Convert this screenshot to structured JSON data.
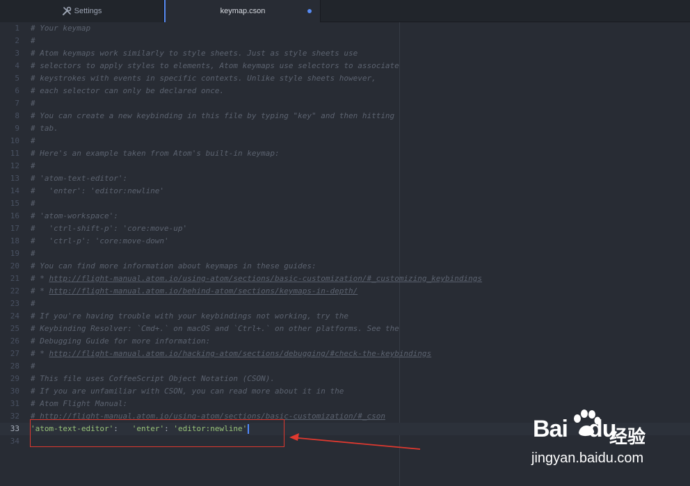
{
  "tabs": [
    {
      "label": "Settings",
      "icon": "tools-icon",
      "active": false
    },
    {
      "label": "keymap.cson",
      "active": true,
      "modified": true
    }
  ],
  "editor": {
    "active_line": 33,
    "lines": [
      {
        "n": "1",
        "segments": [
          {
            "t": "# Your keymap",
            "c": "comment"
          }
        ]
      },
      {
        "n": "2",
        "segments": [
          {
            "t": "#",
            "c": "comment"
          }
        ]
      },
      {
        "n": "3",
        "segments": [
          {
            "t": "# Atom keymaps work similarly to style sheets. Just as style sheets use",
            "c": "comment"
          }
        ]
      },
      {
        "n": "4",
        "segments": [
          {
            "t": "# selectors to apply styles to elements, Atom keymaps use selectors to associate",
            "c": "comment"
          }
        ]
      },
      {
        "n": "5",
        "segments": [
          {
            "t": "# keystrokes with events in specific contexts. Unlike style sheets however,",
            "c": "comment"
          }
        ]
      },
      {
        "n": "6",
        "segments": [
          {
            "t": "# each selector can only be declared once.",
            "c": "comment"
          }
        ]
      },
      {
        "n": "7",
        "segments": [
          {
            "t": "#",
            "c": "comment"
          }
        ]
      },
      {
        "n": "8",
        "segments": [
          {
            "t": "# You can create a new keybinding in this file by typing \"key\" and then hitting",
            "c": "comment"
          }
        ]
      },
      {
        "n": "9",
        "segments": [
          {
            "t": "# tab.",
            "c": "comment"
          }
        ]
      },
      {
        "n": "10",
        "segments": [
          {
            "t": "#",
            "c": "comment"
          }
        ]
      },
      {
        "n": "11",
        "segments": [
          {
            "t": "# Here's an example taken from Atom's built-in keymap:",
            "c": "comment"
          }
        ]
      },
      {
        "n": "12",
        "segments": [
          {
            "t": "#",
            "c": "comment"
          }
        ]
      },
      {
        "n": "13",
        "segments": [
          {
            "t": "# 'atom-text-editor':",
            "c": "comment"
          }
        ]
      },
      {
        "n": "14",
        "segments": [
          {
            "t": "#   'enter': 'editor:newline'",
            "c": "comment"
          }
        ]
      },
      {
        "n": "15",
        "segments": [
          {
            "t": "#",
            "c": "comment"
          }
        ]
      },
      {
        "n": "16",
        "segments": [
          {
            "t": "# 'atom-workspace':",
            "c": "comment"
          }
        ]
      },
      {
        "n": "17",
        "segments": [
          {
            "t": "#   'ctrl-shift-p': 'core:move-up'",
            "c": "comment"
          }
        ]
      },
      {
        "n": "18",
        "segments": [
          {
            "t": "#   'ctrl-p': 'core:move-down'",
            "c": "comment"
          }
        ]
      },
      {
        "n": "19",
        "segments": [
          {
            "t": "#",
            "c": "comment"
          }
        ]
      },
      {
        "n": "20",
        "segments": [
          {
            "t": "# You can find more information about keymaps in these guides:",
            "c": "comment"
          }
        ]
      },
      {
        "n": "21",
        "segments": [
          {
            "t": "# * ",
            "c": "comment"
          },
          {
            "t": "http://flight-manual.atom.io/using-atom/sections/basic-customization/#_customizing_keybindings",
            "c": "link"
          }
        ]
      },
      {
        "n": "22",
        "segments": [
          {
            "t": "# * ",
            "c": "comment"
          },
          {
            "t": "http://flight-manual.atom.io/behind-atom/sections/keymaps-in-depth/",
            "c": "link"
          }
        ]
      },
      {
        "n": "23",
        "segments": [
          {
            "t": "#",
            "c": "comment"
          }
        ]
      },
      {
        "n": "24",
        "segments": [
          {
            "t": "# If you're having trouble with your keybindings not working, try the",
            "c": "comment"
          }
        ]
      },
      {
        "n": "25",
        "segments": [
          {
            "t": "# Keybinding Resolver: `Cmd+.` on macOS and `Ctrl+.` on other platforms. See the",
            "c": "comment"
          }
        ]
      },
      {
        "n": "26",
        "segments": [
          {
            "t": "# Debugging Guide for more information:",
            "c": "comment"
          }
        ]
      },
      {
        "n": "27",
        "segments": [
          {
            "t": "# * ",
            "c": "comment"
          },
          {
            "t": "http://flight-manual.atom.io/hacking-atom/sections/debugging/#check-the-keybindings",
            "c": "link"
          }
        ]
      },
      {
        "n": "28",
        "segments": [
          {
            "t": "#",
            "c": "comment"
          }
        ]
      },
      {
        "n": "29",
        "segments": [
          {
            "t": "# This file uses CoffeeScript Object Notation (CSON).",
            "c": "comment"
          }
        ]
      },
      {
        "n": "30",
        "segments": [
          {
            "t": "# If you are unfamiliar with CSON, you can read more about it in the",
            "c": "comment"
          }
        ]
      },
      {
        "n": "31",
        "segments": [
          {
            "t": "# Atom Flight Manual:",
            "c": "comment"
          }
        ]
      },
      {
        "n": "32",
        "segments": [
          {
            "t": "# ",
            "c": "comment"
          },
          {
            "t": "http://flight-manual.atom.io/using-atom/sections/basic-customization/#_cson",
            "c": "link"
          }
        ]
      },
      {
        "n": "33",
        "segments": [
          {
            "t": "'atom-text-editor'",
            "c": "str"
          },
          {
            "t": ":   ",
            "c": "punc"
          },
          {
            "t": "'enter'",
            "c": "str"
          },
          {
            "t": ": ",
            "c": "punc"
          },
          {
            "t": "'editor:newline'",
            "c": "str"
          }
        ]
      },
      {
        "n": "34",
        "segments": []
      }
    ]
  },
  "annotation": {
    "color": "#e0392f"
  },
  "watermark": {
    "brand_latin": "Bai",
    "brand_du": "du",
    "brand_cn": "经验",
    "url": "jingyan.baidu.com"
  },
  "theme": {
    "background": "#282c34",
    "accent": "#568af2",
    "string": "#98c379",
    "comment": "#5c6370"
  }
}
